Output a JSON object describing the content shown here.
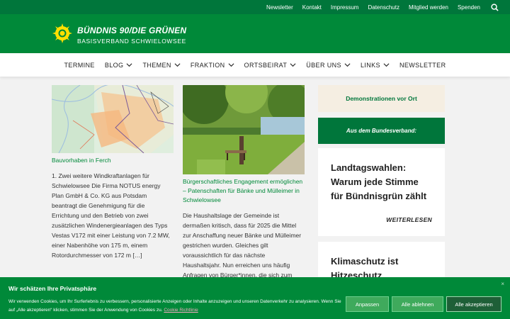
{
  "topbar": {
    "links": [
      "Newsletter",
      "Kontakt",
      "Impressum",
      "Datenschutz",
      "Mitglied werden",
      "Spenden"
    ],
    "search_icon": "search-icon"
  },
  "header": {
    "title": "BÜNDNIS 90/DIE GRÜNEN",
    "subtitle": "BASISVERBAND SCHWIELOWSEE",
    "logo_icon": "sunflower-logo"
  },
  "nav": {
    "items": [
      {
        "label": "TERMINE",
        "dropdown": false
      },
      {
        "label": "BLOG",
        "dropdown": true
      },
      {
        "label": "THEMEN",
        "dropdown": true
      },
      {
        "label": "FRAKTION",
        "dropdown": true
      },
      {
        "label": "ORTSBEIRAT",
        "dropdown": true
      },
      {
        "label": "ÜBER UNS",
        "dropdown": true
      },
      {
        "label": "LINKS",
        "dropdown": true
      },
      {
        "label": "NEWSLETTER",
        "dropdown": false
      }
    ]
  },
  "posts": [
    {
      "title": "Bauvorhaben in Ferch",
      "excerpt": "1. Zwei weitere Windkraftanlagen für Schwielowsee Die Firma NOTUS energy Plan GmbH & Co. KG aus Potsdam beantragt die Genehmigung für die Errichtung und den Betrieb von zwei zusätzlichen Windenergieanlagen des Typs Vestas V172 mit einer Leistung von 7.2 MW, einer Nabenhöhe von 175 m, einem Rotordurchmesser von 172 m […]"
    },
    {
      "title": "Bürgerschaftliches Engagement ermöglichen – Patenschaften für Bänke und Mülleimer in Schwielowsee",
      "excerpt": "Die Haushaltslage der Gemeinde ist dermaßen kritisch, dass für 2025 die Mittel zur Anschaffung neuer Bänke und Mülleimer gestrichen wurden. Gleiches gilt voraussichtlich für das nächste Haushaltsjahr.   Nun erreichen uns häufig Anfragen von Bürger*innen, die sich zum einen zum"
    }
  ],
  "sidebar": {
    "demo_label": "Demonstrationen vor Ort",
    "federal_label": "Aus dem Bundesverband:",
    "cards": [
      {
        "title": "Landtagswahlen: Warum jede Stimme für Bündnisgrün zählt",
        "more": "WEITERLESEN"
      },
      {
        "title": "Klimaschutz ist Hitzeschutz",
        "more": ""
      }
    ]
  },
  "cookie": {
    "title": "Wir schätzen Ihre Privatsphäre",
    "text": "Wir verwenden Cookies, um Ihr Surferlebnis zu verbessern, personalisierte Anzeigen oder Inhalte anzuzeigen und unseren Datenverkehr zu analysieren. Wenn Sie auf „Alle akzeptieren“ klicken, stimmen Sie der Anwendung von Cookies zu.",
    "link": "Cookie Richtlinie",
    "close": "×",
    "buttons": {
      "customize": "Anpassen",
      "decline": "Alle ablehnen",
      "accept": "Alle akzeptieren"
    }
  },
  "colors": {
    "topbar": "#00763b",
    "header": "#008939",
    "accent_text": "#008939",
    "sidebar_demo_bg": "#f5eee2"
  }
}
